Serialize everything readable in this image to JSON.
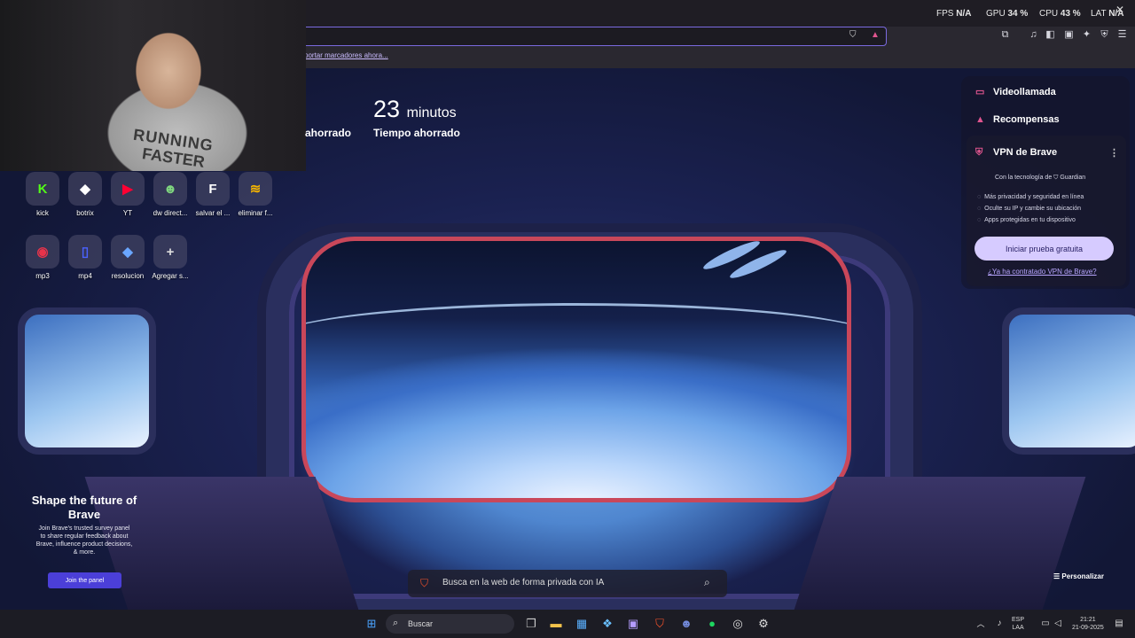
{
  "browser": {
    "bookmarks_prompt": "portar marcadores ahora..."
  },
  "perf_overlay": {
    "fps_label": "FPS",
    "fps_value": "N/A",
    "gpu_label": "GPU",
    "gpu_value": "34 %",
    "cpu_label": "CPU",
    "cpu_value": "43 %",
    "lat_label": "LAT",
    "lat_value": "N/A"
  },
  "webcam": {
    "shirt_line1": "RUNNING",
    "shirt_line2": "FASTER"
  },
  "stats": {
    "time_saved_number": "23",
    "time_saved_unit": "minutos",
    "time_saved_label": "Tiempo ahorrado",
    "partial_label": "ahorrado"
  },
  "shortcuts": [
    {
      "label": "kick",
      "glyph": "K",
      "color": "#53fc18"
    },
    {
      "label": "botrix",
      "glyph": "◆",
      "color": "#ffffff"
    },
    {
      "label": "YT",
      "glyph": "▶",
      "color": "#ff0033"
    },
    {
      "label": "dw direct...",
      "glyph": "☻",
      "color": "#7fd67f"
    },
    {
      "label": "salvar el ...",
      "glyph": "F",
      "color": "#ffffff"
    },
    {
      "label": "eliminar f...",
      "glyph": "≋",
      "color": "#f5b400"
    },
    {
      "label": "mp3",
      "glyph": "◉",
      "color": "#e8334a"
    },
    {
      "label": "mp4",
      "glyph": "▯",
      "color": "#4a62ff"
    },
    {
      "label": "resolucion",
      "glyph": "◆",
      "color": "#6aa6ff"
    },
    {
      "label": "Agregar s...",
      "glyph": "+",
      "color": "#dddddd"
    }
  ],
  "panel": {
    "video_call": "Videollamada",
    "rewards": "Recompensas",
    "vpn_title": "VPN de Brave",
    "powered_by": "Con la tecnología de",
    "guardian": "Guardian",
    "features": [
      "Más privacidad y seguridad en línea",
      "Oculte su IP y cambie su ubicación",
      "Apps protegidas en tu dispositivo"
    ],
    "cta": "Iniciar prueba gratuita",
    "already_link": "¿Ya ha contratado VPN de Brave?"
  },
  "survey": {
    "title": "Shape the future of Brave",
    "body": "Join Brave's trusted survey panel to share regular feedback about Brave, influence product decisions, & more.",
    "button": "Join the panel"
  },
  "search": {
    "placeholder": "Busca en la web de forma privada con IA"
  },
  "customize": "Personalizar",
  "taskbar": {
    "search_label": "Buscar",
    "lang_line1": "ESP",
    "lang_line2": "LAA",
    "time": "21:21",
    "date": "21-09-2025"
  }
}
